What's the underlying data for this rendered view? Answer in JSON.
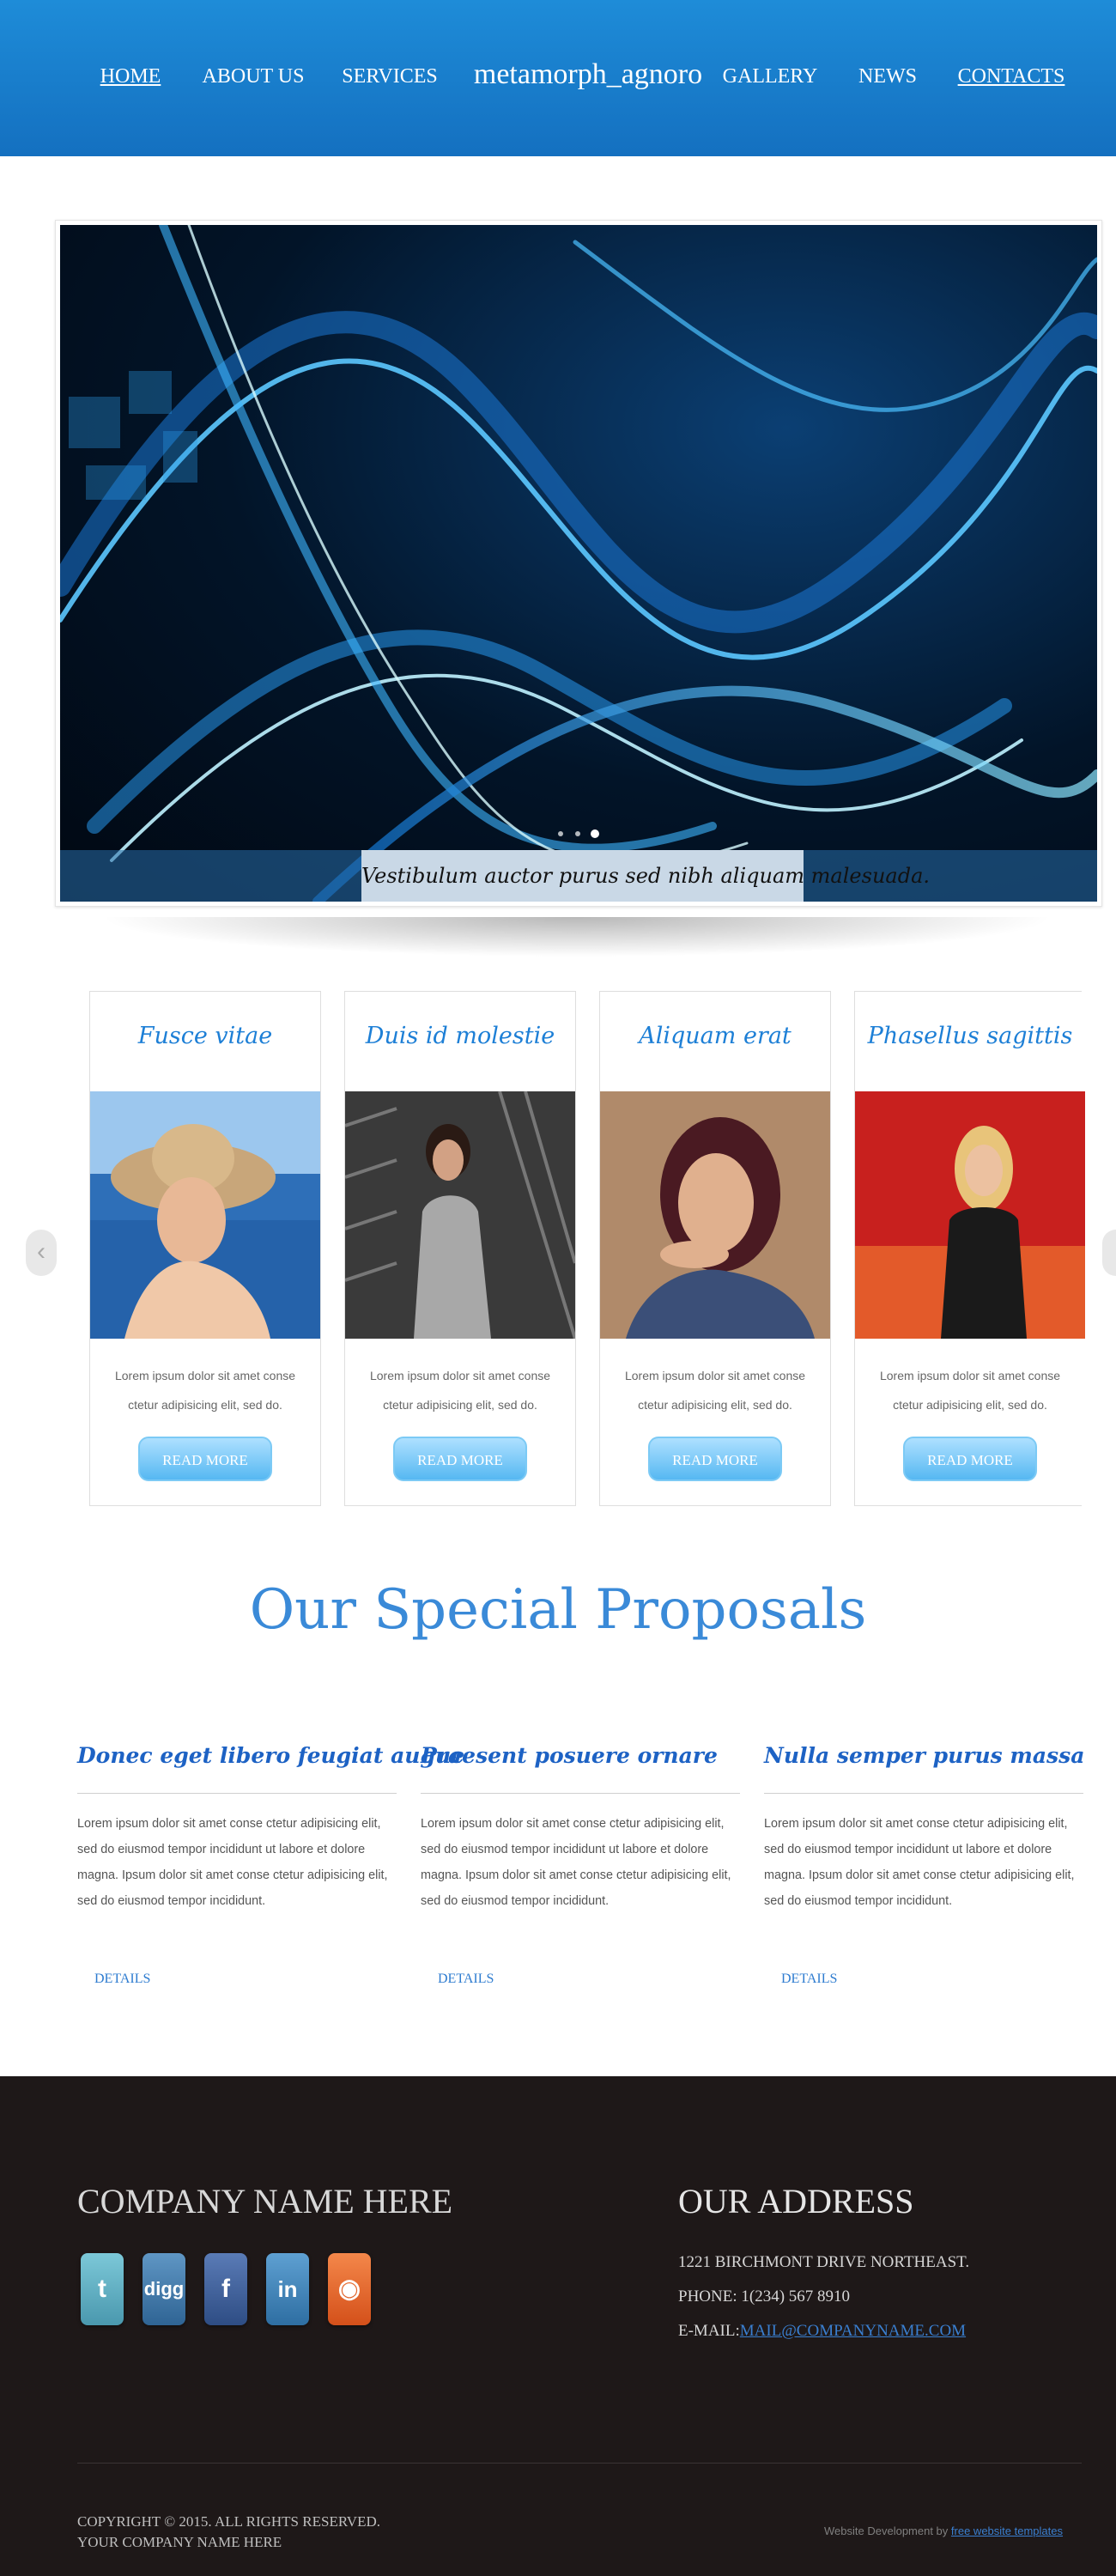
{
  "nav": {
    "brand": "metamorph_agnoro",
    "items": [
      {
        "label": "HOME",
        "active": true
      },
      {
        "label": "ABOUT US",
        "active": false
      },
      {
        "label": "SERVICES",
        "active": false
      },
      {
        "label": "GALLERY",
        "active": false
      },
      {
        "label": "NEWS",
        "active": false
      },
      {
        "label": "CONTACTS",
        "active": true
      }
    ]
  },
  "slider": {
    "caption": "Vestibulum auctor purus sed nibh aliquam malesuada.",
    "dot_count": 3,
    "active_dot": 3
  },
  "carousel": {
    "prev_label": "‹",
    "next_label": "›",
    "cards": [
      {
        "title": "Fusce vitae",
        "text": "Lorem ipsum dolor sit amet conse ctetur adipisicing elit, sed do.",
        "button": "READ MORE"
      },
      {
        "title": "Duis id molestie",
        "text": "Lorem ipsum dolor sit amet conse ctetur adipisicing elit, sed do.",
        "button": "READ MORE"
      },
      {
        "title": "Aliquam erat",
        "text": "Lorem ipsum dolor sit amet conse ctetur adipisicing elit, sed do.",
        "button": "READ MORE"
      },
      {
        "title": "Phasellus sagittis",
        "text": "Lorem ipsum dolor sit amet conse ctetur adipisicing elit, sed do.",
        "button": "READ MORE"
      }
    ]
  },
  "proposals": {
    "title": "Our Special Proposals",
    "items": [
      {
        "title": "Donec eget libero feugiat augue",
        "text": "Lorem ipsum dolor sit amet conse ctetur adipisicing elit, sed do eiusmod tempor incididunt ut labore et dolore magna. Ipsum dolor sit amet conse ctetur adipisicing elit, sed do eiusmod tempor incididunt.",
        "link": "DETAILS"
      },
      {
        "title": "Praesent posuere ornare",
        "text": "Lorem ipsum dolor sit amet conse ctetur adipisicing elit, sed do eiusmod tempor incididunt ut labore et dolore magna. Ipsum dolor sit amet conse ctetur adipisicing elit, sed do eiusmod tempor incididunt.",
        "link": "DETAILS"
      },
      {
        "title": "Nulla semper purus massa",
        "text": "Lorem ipsum dolor sit amet conse ctetur adipisicing elit, sed do eiusmod tempor incididunt ut labore et dolore magna. Ipsum dolor sit amet conse ctetur adipisicing elit, sed do eiusmod tempor incididunt.",
        "link": "DETAILS"
      }
    ]
  },
  "footer": {
    "company": "COMPANY NAME HERE",
    "social": [
      {
        "name": "twitter-icon",
        "glyph": "t",
        "color": "#5fb0c4"
      },
      {
        "name": "digg-icon",
        "glyph": "digg",
        "color": "#3f79a8"
      },
      {
        "name": "facebook-icon",
        "glyph": "f",
        "color": "#3e5f9a"
      },
      {
        "name": "linkedin-icon",
        "glyph": "in",
        "color": "#3f83b8"
      },
      {
        "name": "rss-icon",
        "glyph": "◉",
        "color": "#e8632a"
      }
    ],
    "address_title": "OUR ADDRESS",
    "address_line": "1221 BIRCHMONT DRIVE NORTHEAST.",
    "phone": "PHONE: 1(234) 567 8910",
    "email_label": "E-MAIL:",
    "email": "MAIL@COMPANYNAME.COM",
    "copyright_line1": "COPYRIGHT © 2015. ALL RIGHTS RESERVED.",
    "copyright_line2": "YOUR COMPANY NAME HERE",
    "dev_prefix": "Website Development by",
    "dev_link": "free website templates"
  },
  "colors": {
    "header": "#1a80cf",
    "accent": "#1d7fd6",
    "footer": "#1e1818"
  }
}
